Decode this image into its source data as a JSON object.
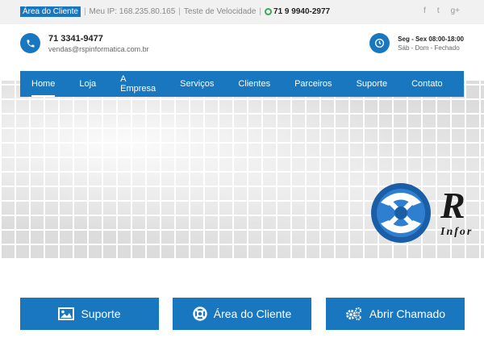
{
  "topbar": {
    "client_area": "Área do Cliente",
    "ip_text": "Meu IP: 168.235.80.165",
    "speed_test": "Teste de Velocidade",
    "whatsapp": "71 9 9940-2977",
    "social": [
      "f",
      "t",
      "g+"
    ]
  },
  "contact": {
    "phone": "71 3341-9477",
    "email": "vendas@rspinformatica.com.br",
    "hours_week": "Seg - Sex 08:00-18:00",
    "hours_weekend": "Sáb - Dom - Fechado"
  },
  "nav": {
    "items": [
      "Home",
      "Loja",
      "A Empresa",
      "Serviços",
      "Clientes",
      "Parceiros",
      "Suporte",
      "Contato"
    ]
  },
  "brand": {
    "big": "R",
    "sub": "Infor"
  },
  "buttons": {
    "suporte": "Suporte",
    "area_cliente": "Área do Cliente",
    "abrir_chamado": "Abrir Chamado"
  },
  "colors": {
    "primary": "#1977c0",
    "whatsapp": "#3aa85b",
    "topbar_bg": "#f1f1f1"
  }
}
